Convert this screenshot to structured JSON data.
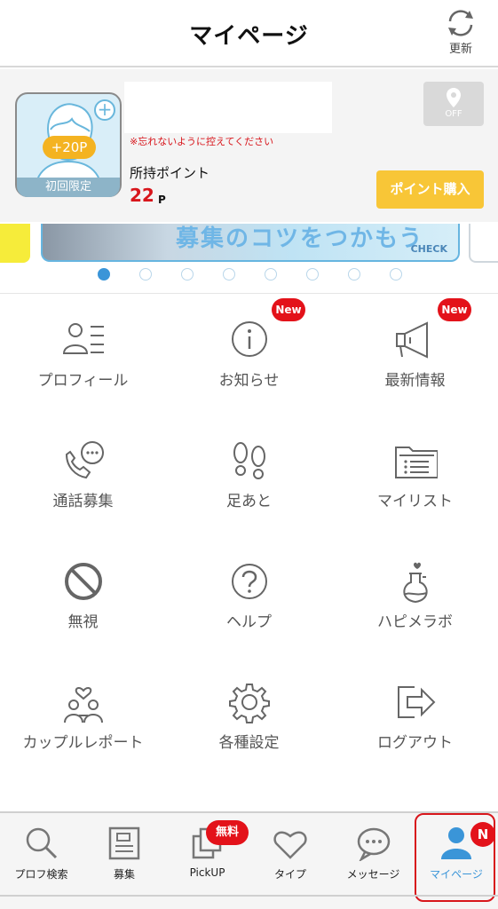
{
  "header": {
    "title": "マイページ",
    "refresh_label": "更新"
  },
  "profile": {
    "bonus": "+20P",
    "first_time_label": "初回限定",
    "warning": "※忘れないように控えてください",
    "points_label": "所持ポイント",
    "points_value": "22",
    "points_unit": "P",
    "location_status": "OFF",
    "buy_label": "ポイント購入"
  },
  "banner": {
    "text": "募集のコツをつかもう",
    "check_label": "CHECK",
    "page_count": 8,
    "active_index": 0
  },
  "menu": [
    {
      "label": "プロフィール",
      "icon": "profile-list-icon",
      "badge": ""
    },
    {
      "label": "お知らせ",
      "icon": "info-icon",
      "badge": "New"
    },
    {
      "label": "最新情報",
      "icon": "megaphone-icon",
      "badge": "New"
    },
    {
      "label": "通話募集",
      "icon": "phone-chat-icon",
      "badge": ""
    },
    {
      "label": "足あと",
      "icon": "footprints-icon",
      "badge": ""
    },
    {
      "label": "マイリスト",
      "icon": "folder-list-icon",
      "badge": ""
    },
    {
      "label": "無視",
      "icon": "block-icon",
      "badge": ""
    },
    {
      "label": "ヘルプ",
      "icon": "help-icon",
      "badge": ""
    },
    {
      "label": "ハピメラボ",
      "icon": "flask-icon",
      "badge": ""
    },
    {
      "label": "カップルレポート",
      "icon": "couple-icon",
      "badge": ""
    },
    {
      "label": "各種設定",
      "icon": "gear-icon",
      "badge": ""
    },
    {
      "label": "ログアウト",
      "icon": "logout-icon",
      "badge": ""
    }
  ],
  "tabs": [
    {
      "label": "プロフ検索",
      "icon": "search-icon"
    },
    {
      "label": "募集",
      "icon": "board-icon"
    },
    {
      "label": "PickUP",
      "icon": "photos-icon",
      "badge": "無料"
    },
    {
      "label": "タイプ",
      "icon": "heart-icon"
    },
    {
      "label": "メッセージ",
      "icon": "message-bubble-icon"
    },
    {
      "label": "マイページ",
      "icon": "person-icon",
      "badge": "N",
      "active": true
    }
  ],
  "colors": {
    "accent_blue": "#3a95d8",
    "badge_red": "#e3121a",
    "buy_yellow": "#f8c637",
    "bonus_orange": "#f4b321"
  }
}
